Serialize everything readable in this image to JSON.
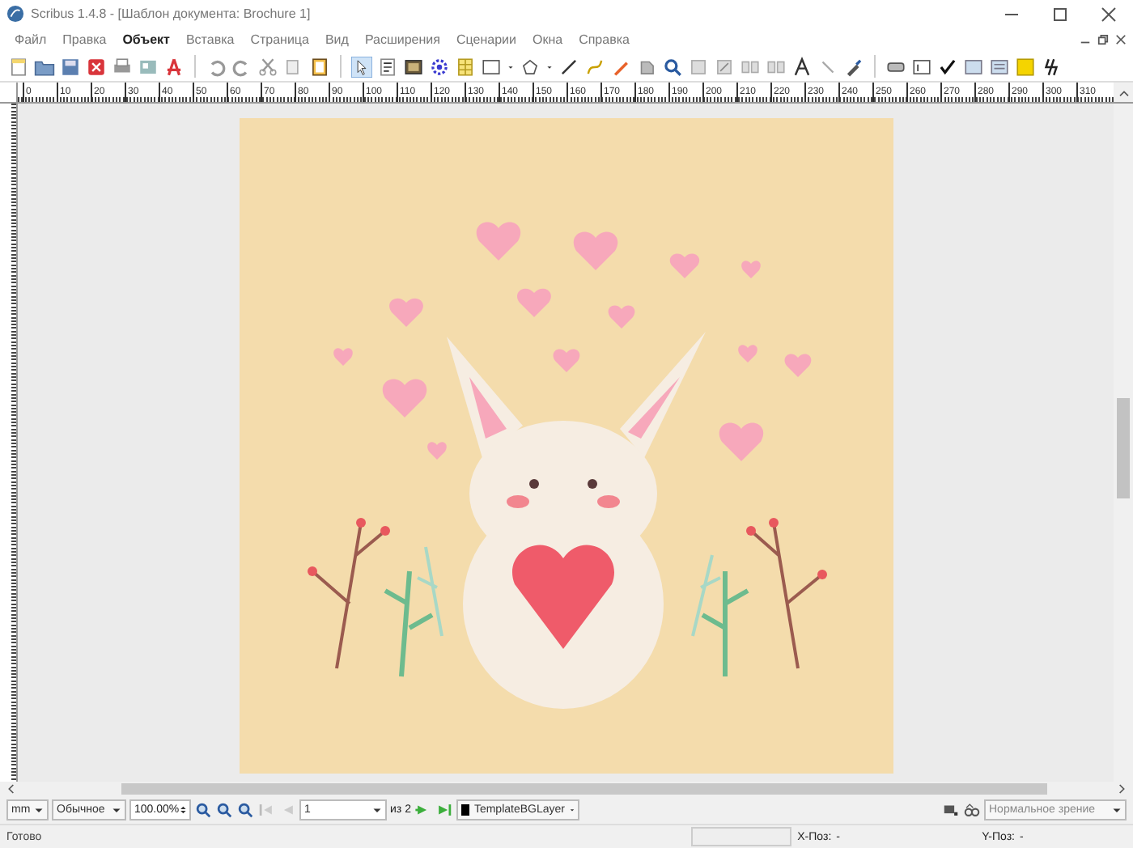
{
  "window": {
    "title": "Scribus 1.4.8 - [Шаблон документа: Brochure 1]"
  },
  "menu": [
    {
      "label": "Файл",
      "selected": false
    },
    {
      "label": "Правка",
      "selected": false
    },
    {
      "label": "Объект",
      "selected": true
    },
    {
      "label": "Вставка",
      "selected": false
    },
    {
      "label": "Страница",
      "selected": false
    },
    {
      "label": "Вид",
      "selected": false
    },
    {
      "label": "Расширения",
      "selected": false
    },
    {
      "label": "Сценарии",
      "selected": false
    },
    {
      "label": "Окна",
      "selected": false
    },
    {
      "label": "Справка",
      "selected": false
    }
  ],
  "ruler": {
    "labels": [
      "0",
      "10",
      "20",
      "30",
      "40",
      "50",
      "60",
      "70",
      "80",
      "90",
      "100",
      "110",
      "120",
      "130",
      "140",
      "150",
      "160",
      "170",
      "180",
      "190",
      "200",
      "210",
      "220",
      "230",
      "240",
      "250",
      "260",
      "270",
      "280",
      "290",
      "300",
      "310"
    ]
  },
  "bottom_toolbar": {
    "unit": "mm",
    "mode": "Обычное",
    "zoom": "100.00%",
    "page": "1",
    "page_count": "из 2",
    "layer": "TemplateBGLayer",
    "vision": "Нормальное зрение"
  },
  "status_bar": {
    "text": "Готово",
    "x_label": "X-Поз:",
    "x_value": "-",
    "y_label": "Y-Поз:",
    "y_value": "-"
  }
}
